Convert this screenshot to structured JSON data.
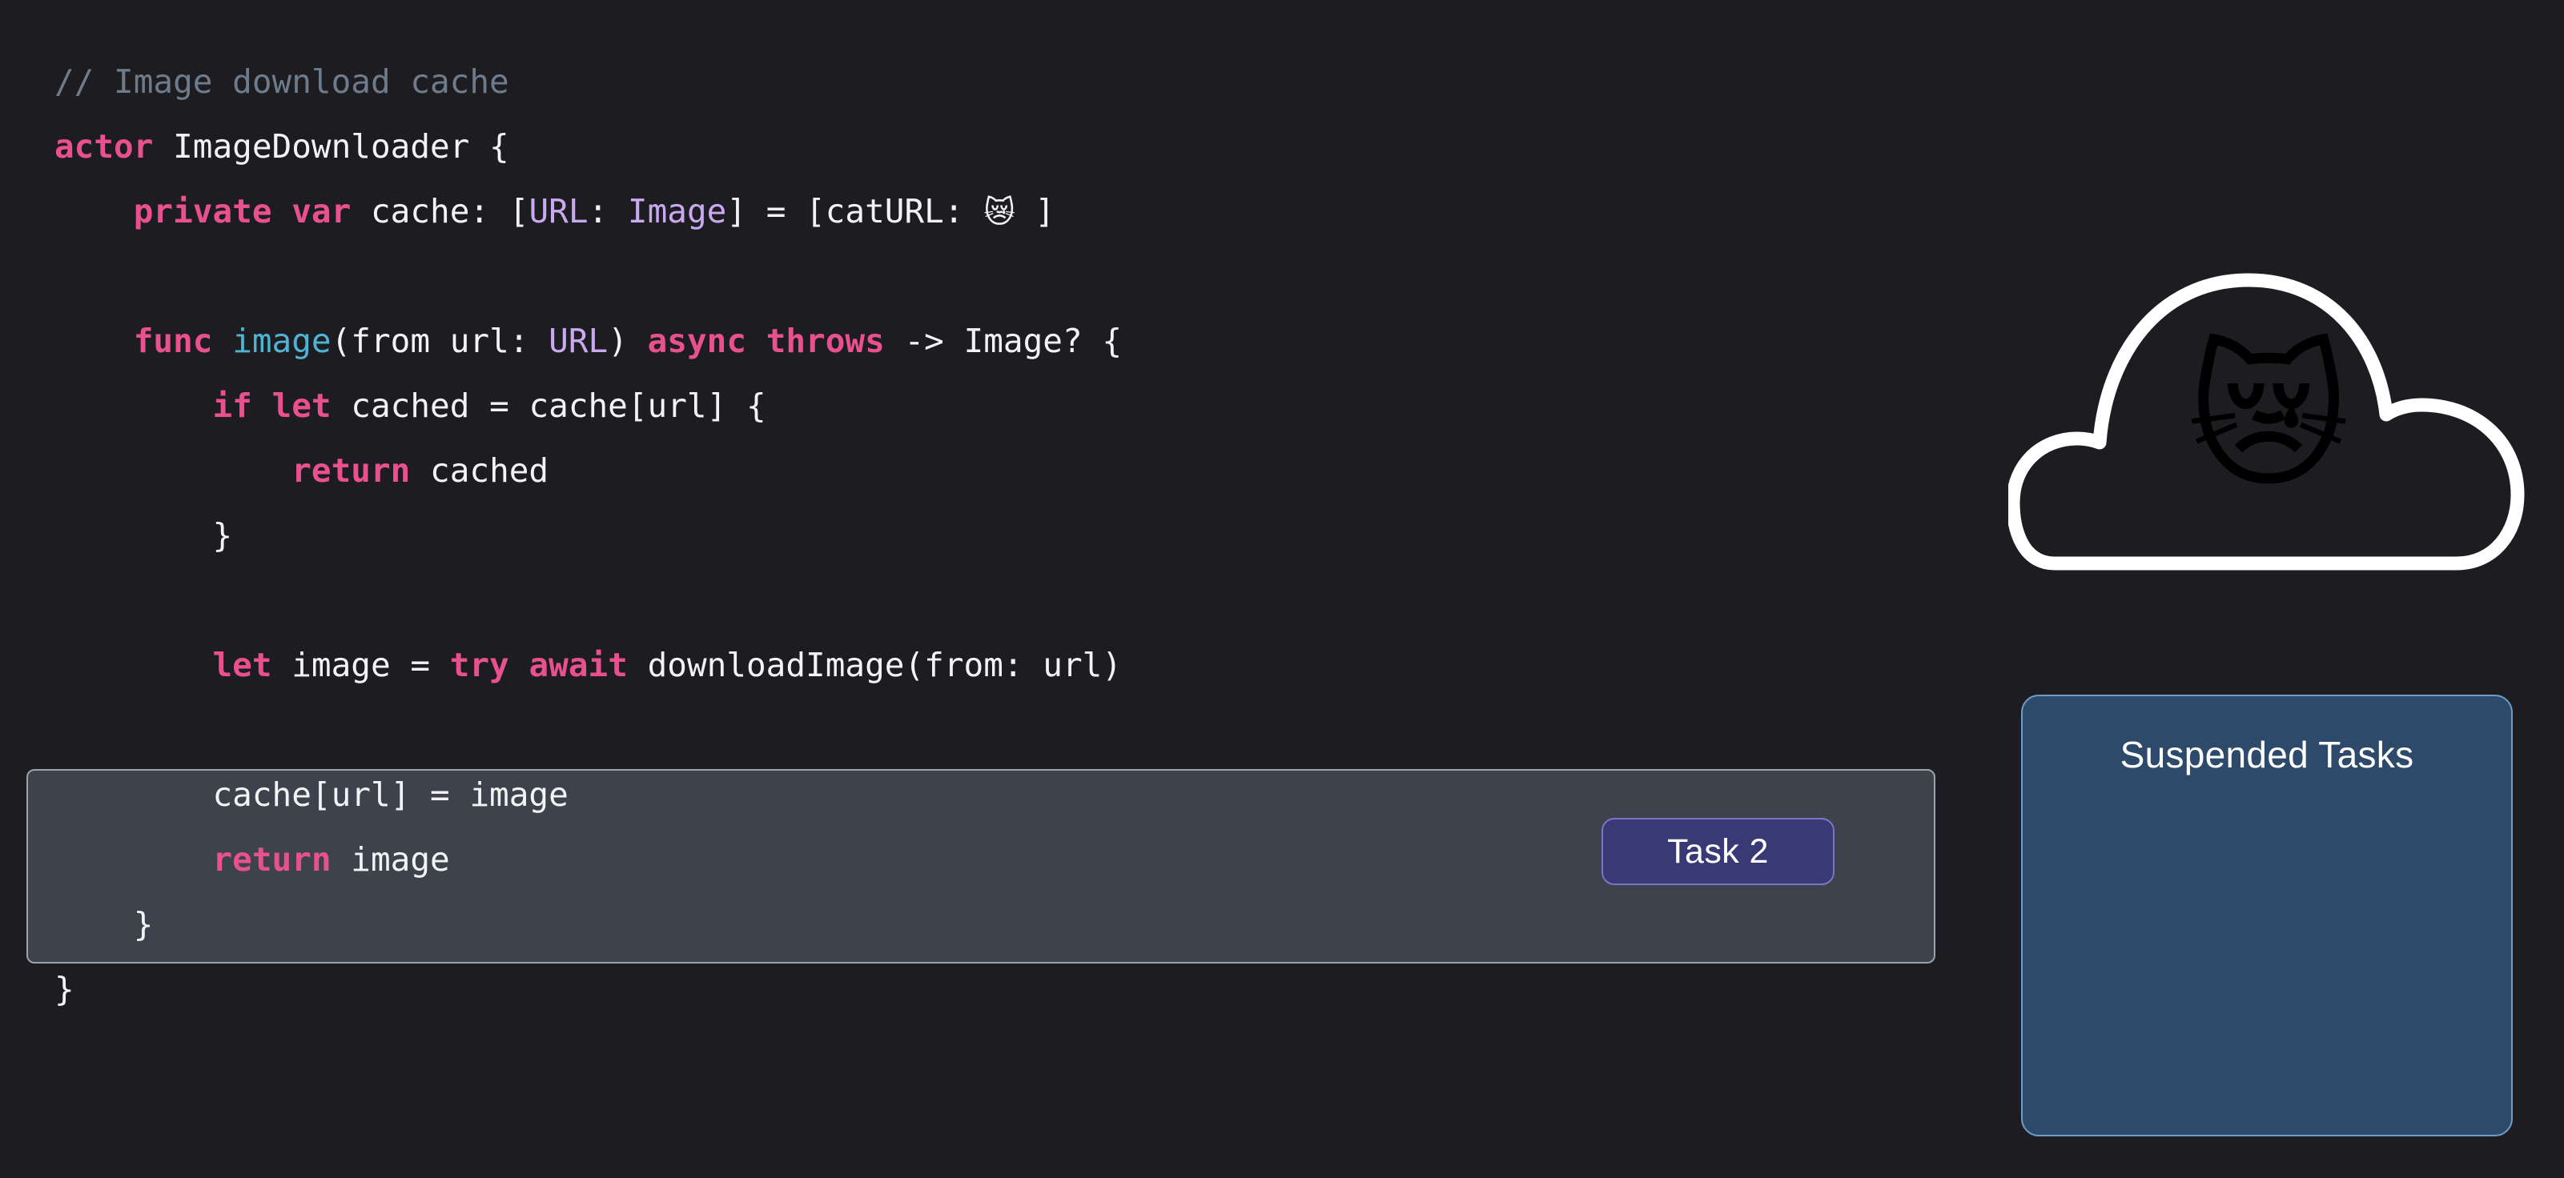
{
  "theme": {
    "background": "#1d1d21",
    "code_text": "#f3f3f5",
    "keyword": "#e8518e",
    "type": "#c9aaf0",
    "function": "#4fb3d4",
    "comment": "#6d7b8b",
    "highlight_fill": "#3d424d",
    "highlight_border": "#9aa2ae",
    "task_button_fill": "#393a75",
    "task_button_border": "#7d74c4",
    "panel_fill": "#2d4a6b",
    "panel_border": "#6f9cc9",
    "cloud_stroke": "#ffffff"
  },
  "code": {
    "language": "swift",
    "lines": [
      {
        "indent": 0,
        "tokens": [
          {
            "t": "// Image download cache",
            "c": "cmt"
          }
        ]
      },
      {
        "indent": 0,
        "tokens": [
          {
            "t": "actor",
            "c": "kw"
          },
          {
            "t": " ImageDownloader {",
            "c": "pln"
          }
        ]
      },
      {
        "indent": 1,
        "tokens": [
          {
            "t": "private",
            "c": "kw"
          },
          {
            "t": " ",
            "c": "pln"
          },
          {
            "t": "var",
            "c": "kw"
          },
          {
            "t": " cache: [",
            "c": "pln"
          },
          {
            "t": "URL",
            "c": "type"
          },
          {
            "t": ": ",
            "c": "pln"
          },
          {
            "t": "Image",
            "c": "type"
          },
          {
            "t": "] = [catURL: ",
            "c": "pln"
          },
          {
            "t": "😿",
            "c": "emoji"
          },
          {
            "t": " ]",
            "c": "pln"
          }
        ]
      },
      {
        "indent": 0,
        "tokens": [
          {
            "t": "",
            "c": "pln"
          }
        ]
      },
      {
        "indent": 1,
        "tokens": [
          {
            "t": "func",
            "c": "kw"
          },
          {
            "t": " ",
            "c": "pln"
          },
          {
            "t": "image",
            "c": "fn"
          },
          {
            "t": "(from url: ",
            "c": "pln"
          },
          {
            "t": "URL",
            "c": "type"
          },
          {
            "t": ") ",
            "c": "pln"
          },
          {
            "t": "async",
            "c": "kw"
          },
          {
            "t": " ",
            "c": "pln"
          },
          {
            "t": "throws",
            "c": "kw"
          },
          {
            "t": " -> Image? {",
            "c": "pln"
          }
        ]
      },
      {
        "indent": 2,
        "tokens": [
          {
            "t": "if",
            "c": "kw"
          },
          {
            "t": " ",
            "c": "pln"
          },
          {
            "t": "let",
            "c": "kw"
          },
          {
            "t": " cached = cache[url] {",
            "c": "pln"
          }
        ]
      },
      {
        "indent": 3,
        "tokens": [
          {
            "t": "return",
            "c": "kw"
          },
          {
            "t": " cached",
            "c": "pln"
          }
        ]
      },
      {
        "indent": 2,
        "tokens": [
          {
            "t": "}",
            "c": "pln"
          }
        ]
      },
      {
        "indent": 0,
        "tokens": [
          {
            "t": "",
            "c": "pln"
          }
        ]
      },
      {
        "indent": 2,
        "tokens": [
          {
            "t": "let",
            "c": "kw"
          },
          {
            "t": " image = ",
            "c": "pln"
          },
          {
            "t": "try",
            "c": "kw"
          },
          {
            "t": " ",
            "c": "pln"
          },
          {
            "t": "await",
            "c": "kw"
          },
          {
            "t": " downloadImage(from: url)",
            "c": "pln"
          }
        ]
      },
      {
        "indent": 0,
        "tokens": [
          {
            "t": "",
            "c": "pln"
          }
        ]
      },
      {
        "indent": 2,
        "tokens": [
          {
            "t": "cache[url] = image",
            "c": "pln"
          }
        ]
      },
      {
        "indent": 2,
        "tokens": [
          {
            "t": "return",
            "c": "kw"
          },
          {
            "t": " image",
            "c": "pln"
          }
        ]
      },
      {
        "indent": 1,
        "tokens": [
          {
            "t": "}",
            "c": "pln"
          }
        ]
      },
      {
        "indent": 0,
        "tokens": [
          {
            "t": "}",
            "c": "pln"
          }
        ]
      }
    ]
  },
  "task_button": {
    "label": "Task 2"
  },
  "suspended_panel": {
    "title": "Suspended Tasks"
  },
  "cloud": {
    "emoji": "😿",
    "icon_name": "crying-cat-face"
  }
}
